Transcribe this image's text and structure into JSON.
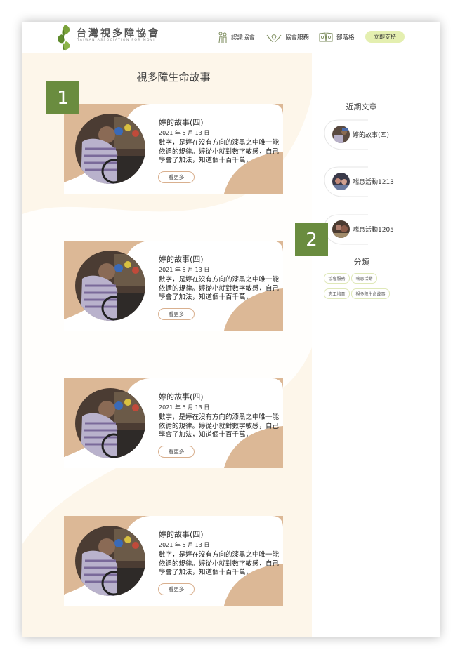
{
  "header": {
    "logo_cn": "台灣視多障協會",
    "logo_en": "TAIWAN ASSOCIATION FOR MDVI",
    "nav": [
      {
        "label": "認識協會",
        "icon": "people-icon"
      },
      {
        "label": "協會服務",
        "icon": "hands-icon"
      },
      {
        "label": "部落格",
        "icon": "book-icon"
      }
    ],
    "cta_label": "立即支持"
  },
  "main": {
    "section_title": "視多障生命故事",
    "posts": [
      {
        "title": "婷的故事(四)",
        "date": "2021 年 5 月 13 日",
        "excerpt": "數字，是婷在沒有方向的漆黑之中唯一能依循的規律。婷從小就對數字敏感，自己學會了加法，知道個十百千萬，",
        "more": "看更多"
      },
      {
        "title": "婷的故事(四)",
        "date": "2021 年 5 月 13 日",
        "excerpt": "數字，是婷在沒有方向的漆黑之中唯一能依循的規律。婷從小就對數字敏感，自己學會了加法，知道個十百千萬，",
        "more": "看更多"
      },
      {
        "title": "婷的故事(四)",
        "date": "2021 年 5 月 13 日",
        "excerpt": "數字，是婷在沒有方向的漆黑之中唯一能依循的規律。婷從小就對數字敏感，自己學會了加法，知道個十百千萬，",
        "more": "看更多"
      },
      {
        "title": "婷的故事(四)",
        "date": "2021 年 5 月 13 日",
        "excerpt": "數字，是婷在沒有方向的漆黑之中唯一能依循的規律。婷從小就對數字敏感，自己學會了加法，知道個十百千萬，",
        "more": "看更多"
      }
    ]
  },
  "sidebar": {
    "recent_title": "近期文章",
    "recent": [
      {
        "label": "婷的故事(四)"
      },
      {
        "label": "喘息活動1213"
      },
      {
        "label": "喘息活動1205"
      }
    ],
    "category_title": "分類",
    "tags": [
      "協會服務",
      "喘息活動",
      "志工培育",
      "視多障生命故事"
    ]
  },
  "annotations": {
    "badge_1": "1",
    "badge_2": "2"
  },
  "colors": {
    "accent_green": "#6a8c3f",
    "tan": "#dcb896",
    "cream": "#fdf6ea",
    "cta": "#e4efb0"
  }
}
